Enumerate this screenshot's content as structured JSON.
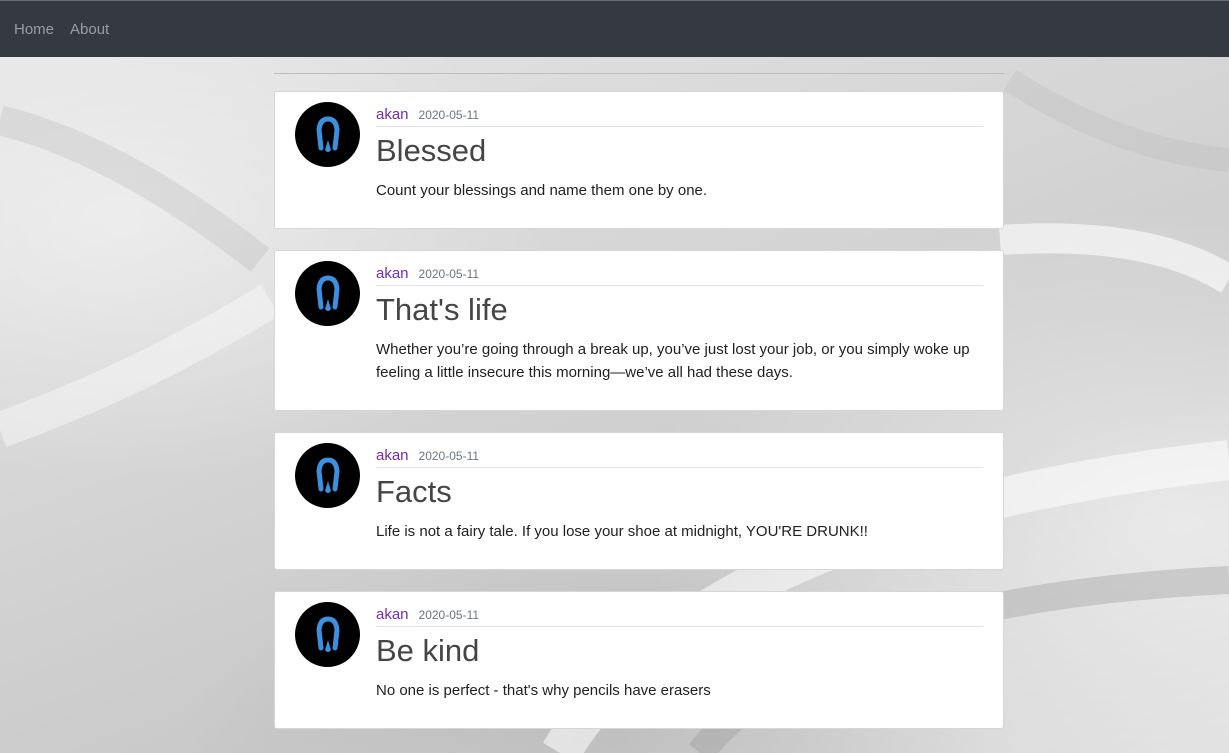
{
  "nav": {
    "items": [
      {
        "label": "Home"
      },
      {
        "label": "About"
      }
    ]
  },
  "posts": [
    {
      "author": "akan",
      "date": "2020-05-11",
      "title": "Blessed",
      "content": "Count your blessings and name them one by one."
    },
    {
      "author": "akan",
      "date": "2020-05-11",
      "title": "That's life",
      "content": "Whether you’re going through a break up, you’ve just lost your job, or you simply woke up feeling a little insecure this morning—we’ve all had these days."
    },
    {
      "author": "akan",
      "date": "2020-05-11",
      "title": "Facts",
      "content": "Life is not a fairy tale. If you lose your shoe at midnight, YOU'RE DRUNK!!"
    },
    {
      "author": "akan",
      "date": "2020-05-11",
      "title": "Be kind",
      "content": "No one is perfect - that's why pencils have erasers"
    }
  ],
  "colors": {
    "navbar": "#343a40",
    "author_link": "#6f2db3",
    "avatar_accent": "#3d8fe0"
  },
  "icons": {
    "avatar": "horseshoe-logo-icon"
  }
}
